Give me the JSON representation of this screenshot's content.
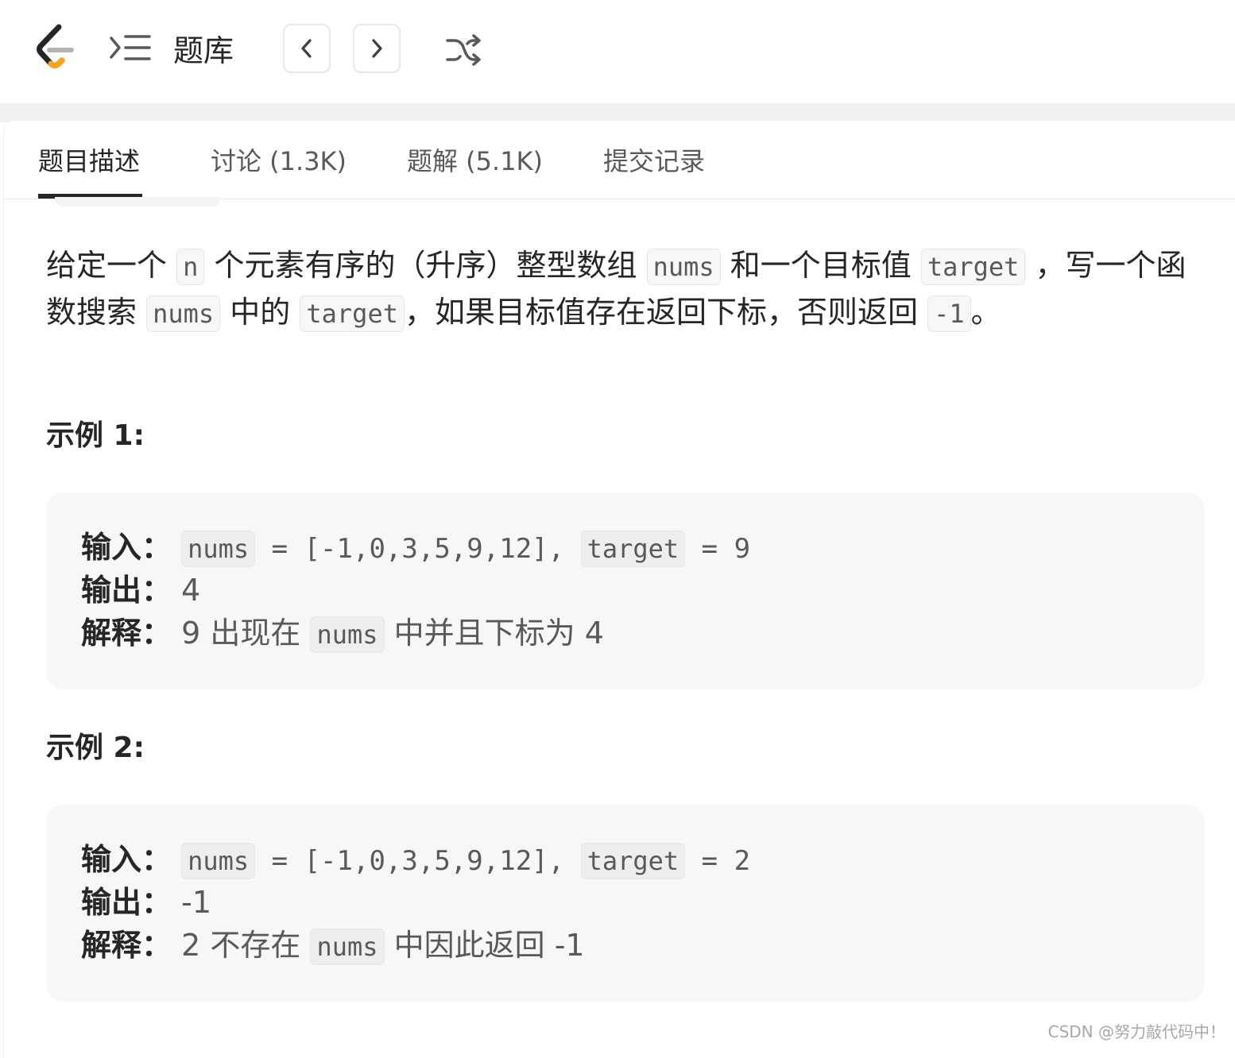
{
  "header": {
    "logo_icon": "leetcode-logo-icon",
    "list_icon": "list-toggle-icon",
    "title": "题库",
    "prev_icon": "chevron-left-icon",
    "next_icon": "chevron-right-icon",
    "shuffle_icon": "shuffle-icon"
  },
  "tabs": [
    {
      "label": "题目描述",
      "active": true
    },
    {
      "label": "讨论 (1.3K)",
      "active": false
    },
    {
      "label": "题解 (5.1K)",
      "active": false
    },
    {
      "label": "提交记录",
      "active": false
    }
  ],
  "description": {
    "p1": "给定一个",
    "c1": "n",
    "p2": "个元素有序的（升序）整型数组",
    "c2": "nums",
    "p3": "和一个目标值",
    "c3": "target",
    "p4": "，写一个函数搜索",
    "c4": "nums",
    "p5": "中的",
    "c5": "target",
    "p6": "，如果目标值存在返回下标，否则返回",
    "c6": "-1",
    "p7": "。"
  },
  "examples": [
    {
      "title": "示例 1:",
      "input_label": "输入：",
      "input_code1": "nums",
      "input_value": " = [-1,0,3,5,9,12], ",
      "input_code2": "target",
      "input_value2": " = 9",
      "output_label": "输出：",
      "output_value": "4",
      "explain_label": "解释：",
      "explain_text1": "9 出现在",
      "explain_code": "nums",
      "explain_text2": "中并且下标为 4"
    },
    {
      "title": "示例 2:",
      "input_label": "输入：",
      "input_code1": "nums",
      "input_value": " = [-1,0,3,5,9,12], ",
      "input_code2": "target",
      "input_value2": " = 2",
      "output_label": "输出：",
      "output_value": "-1",
      "explain_label": "解释：",
      "explain_text1": "2 不存在",
      "explain_code": "nums",
      "explain_text2": "中因此返回 -1"
    }
  ],
  "watermark": "CSDN @努力敲代码中！",
  "colors": {
    "accent_orange": "#FFA116",
    "text_primary": "#262626",
    "text_secondary": "#595959",
    "code_bg": "#f7f7f7",
    "example_bg": "#f7f7f8"
  }
}
